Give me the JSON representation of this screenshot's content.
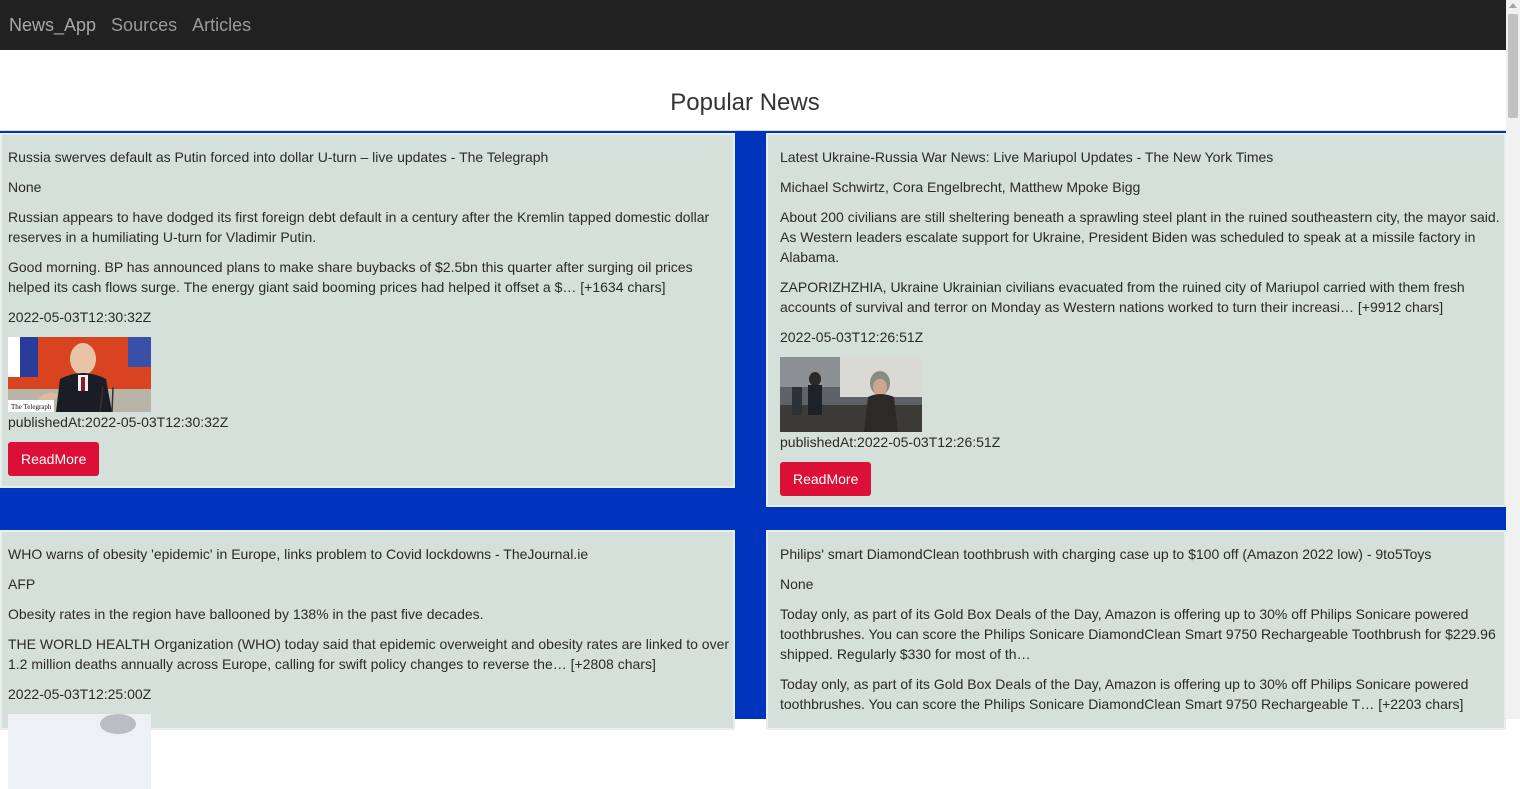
{
  "navbar": {
    "brand": "News_App",
    "links": [
      "Sources",
      "Articles"
    ]
  },
  "heading": "Popular News",
  "articles": [
    {
      "title": "Russia swerves default as Putin forced into dollar U-turn – live updates - The Telegraph",
      "author": "None",
      "description": "Russian appears to have dodged its first foreign debt default in a century after the Kremlin tapped domestic dollar reserves in a humiliating U-turn for Vladimir Putin.",
      "content": "Good morning. BP has announced plans to make share buybacks of $2.5bn this quarter after surging oil prices helped its cash flows surge. The energy giant said booming prices had helped it offset a $… [+1634 chars]",
      "date": "2022-05-03T12:30:32Z",
      "published": "publishedAt:2022-05-03T12:30:32Z",
      "image_caption": "The Telegraph",
      "button": "ReadMore"
    },
    {
      "title": "Latest Ukraine-Russia War News: Live Mariupol Updates - The New York Times",
      "author": "Michael Schwirtz, Cora Engelbrecht, Matthew Mpoke Bigg",
      "description": "About 200 civilians are still sheltering beneath a sprawling steel plant in the ruined southeastern city, the mayor said. As Western leaders escalate support for Ukraine, President Biden was scheduled to speak at a missile factory in Alabama.",
      "content": "ZAPORIZHZHIA, Ukraine Ukrainian civilians evacuated from the ruined city of Mariupol carried with them fresh accounts of survival and terror on Monday as Western nations worked to turn their increasi… [+9912 chars]",
      "date": "2022-05-03T12:26:51Z",
      "published": "publishedAt:2022-05-03T12:26:51Z",
      "button": "ReadMore"
    },
    {
      "title": "WHO warns of obesity 'epidemic' in Europe, links problem to Covid lockdowns - TheJournal.ie",
      "author": "AFP",
      "description": "Obesity rates in the region have ballooned by 138% in the past five decades.",
      "content": "THE WORLD HEALTH Organization (WHO) today said that epidemic overweight and obesity rates are linked to over 1.2 million deaths annually across Europe, calling for swift policy changes to reverse the… [+2808 chars]",
      "date": "2022-05-03T12:25:00Z"
    },
    {
      "title": "Philips' smart DiamondClean toothbrush with charging case up to $100 off (Amazon 2022 low) - 9to5Toys",
      "author": "None",
      "description": "Today only, as part of its Gold Box Deals of the Day, Amazon is offering up to 30% off Philips Sonicare powered toothbrushes. You can score the Philips Sonicare DiamondClean Smart 9750 Rechargeable Toothbrush for $229.96 shipped. Regularly $330 for most of th…",
      "content": "Today only, as part of its Gold Box Deals of the Day, Amazon is offering up to 30% off Philips Sonicare powered toothbrushes. You can score the Philips Sonicare DiamondClean Smart 9750 Rechargeable T… [+2203 chars]"
    }
  ]
}
